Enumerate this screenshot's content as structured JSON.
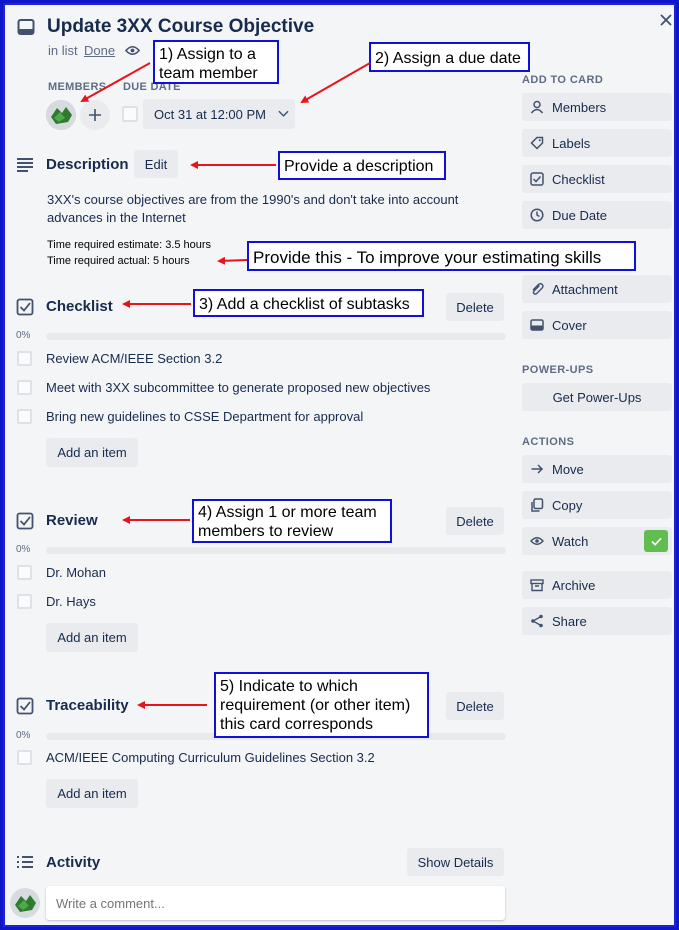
{
  "card": {
    "title": "Update 3XX Course Objective",
    "in_list_prefix": "in list",
    "list_name": "Done"
  },
  "members": {
    "label": "MEMBERS"
  },
  "due_date": {
    "label": "DUE DATE",
    "value": "Oct 31 at 12:00 PM"
  },
  "description": {
    "title": "Description",
    "edit_label": "Edit",
    "text_line1": "3XX's course objectives are from the 1990's and don't take into account",
    "text_line2": "advances in the Internet",
    "estimate": "Time required estimate: 3.5 hours",
    "actual": "Time required actual: 5 hours"
  },
  "checklists": [
    {
      "title": "Checklist",
      "percent": "0%",
      "delete_label": "Delete",
      "items": [
        "Review ACM/IEEE Section 3.2",
        "Meet with 3XX subcommittee to generate proposed new objectives",
        "Bring new guidelines to CSSE Department for approval"
      ],
      "add_label": "Add an item"
    },
    {
      "title": "Review",
      "percent": "0%",
      "delete_label": "Delete",
      "items": [
        "Dr. Mohan",
        "Dr. Hays"
      ],
      "add_label": "Add an item"
    },
    {
      "title": "Traceability",
      "percent": "0%",
      "delete_label": "Delete",
      "items": [
        "ACM/IEEE Computing Curriculum Guidelines Section 3.2"
      ],
      "add_label": "Add an item"
    }
  ],
  "activity": {
    "title": "Activity",
    "show_details_label": "Show Details",
    "comment_placeholder": "Write a comment..."
  },
  "sidebar": {
    "add_to_card_heading": "ADD TO CARD",
    "add_to_card": [
      {
        "label": "Members",
        "icon": "person-icon"
      },
      {
        "label": "Labels",
        "icon": "tag-icon"
      },
      {
        "label": "Checklist",
        "icon": "checklist-icon"
      },
      {
        "label": "Due Date",
        "icon": "clock-icon"
      },
      {
        "label": "Attachment",
        "icon": "paperclip-icon"
      },
      {
        "label": "Cover",
        "icon": "cover-icon"
      }
    ],
    "power_ups_heading": "POWER-UPS",
    "get_power_ups_label": "Get Power-Ups",
    "actions_heading": "ACTIONS",
    "actions": [
      {
        "label": "Move",
        "icon": "arrow-right-icon"
      },
      {
        "label": "Copy",
        "icon": "copy-icon"
      },
      {
        "label": "Watch",
        "icon": "eye-icon"
      },
      {
        "label": "Archive",
        "icon": "archive-icon"
      },
      {
        "label": "Share",
        "icon": "share-icon"
      }
    ],
    "watch_active_color": "#61bd4f"
  },
  "annotations": {
    "c1": [
      "1) Assign to a",
      "team member"
    ],
    "c2": "2) Assign a due date",
    "c3": "Provide a description",
    "c4": "Provide this - To improve your estimating skills",
    "c5": "3) Add a checklist of subtasks",
    "c6": [
      "4) Assign 1 or more team",
      "members to review"
    ],
    "c7": [
      "5) Indicate to which",
      "requirement (or other item)",
      "this card corresponds"
    ],
    "arrow_color": "#e8141c",
    "box_color": "#1010d8"
  }
}
